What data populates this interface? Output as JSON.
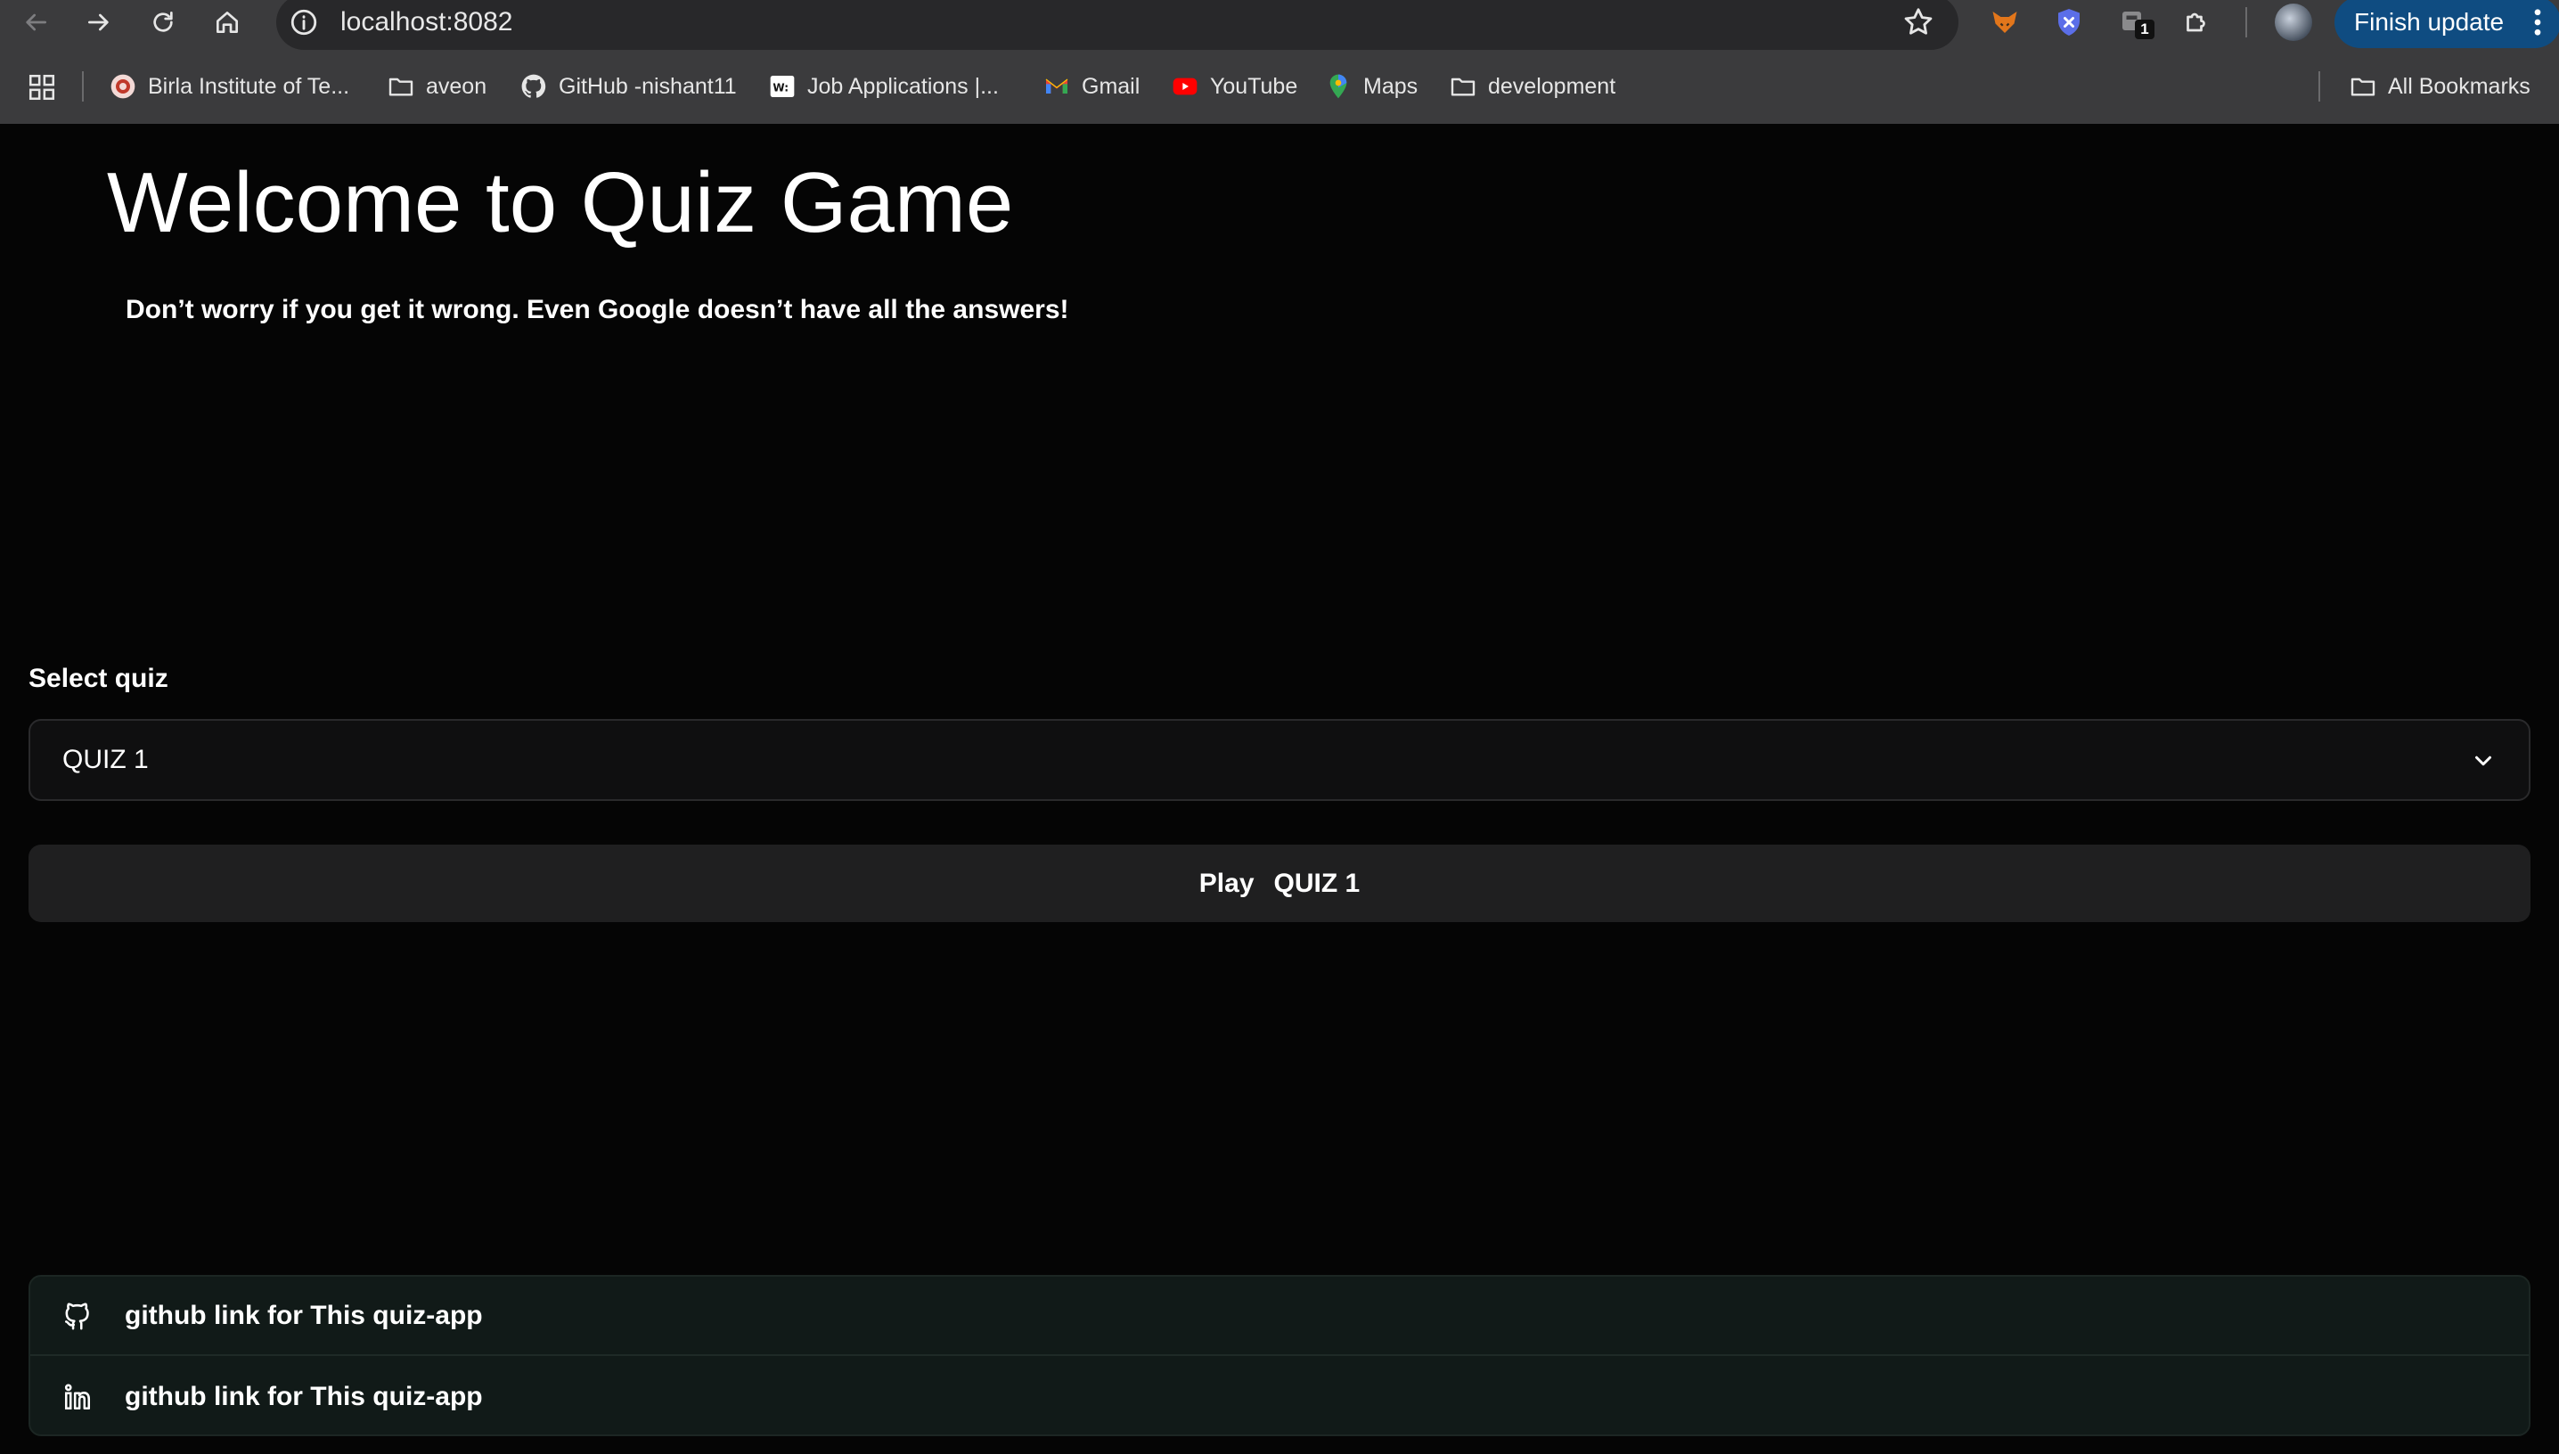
{
  "browser": {
    "url": "localhost:8082",
    "update_button": "Finish update",
    "extension_badge": "1",
    "bookmarks": [
      {
        "label": "Birla Institute of Te...",
        "icon": "site-favicon-icon"
      },
      {
        "label": "aveon",
        "icon": "folder-icon"
      },
      {
        "label": "GitHub -nishant11",
        "icon": "github-icon"
      },
      {
        "label": "Job Applications |...",
        "icon": "wellfound-icon"
      },
      {
        "label": "Gmail",
        "icon": "gmail-icon"
      },
      {
        "label": "YouTube",
        "icon": "youtube-icon"
      },
      {
        "label": "Maps",
        "icon": "maps-icon"
      },
      {
        "label": "development",
        "icon": "folder-icon"
      }
    ],
    "all_bookmarks": "All Bookmarks"
  },
  "hero": {
    "title": "Welcome to Quiz Game",
    "subtitle": "Don’t worry if you get it wrong. Even Google doesn’t have all the answers!"
  },
  "quiz": {
    "select_label": "Select quiz",
    "selected_value": "QUIZ 1",
    "play_prefix": "Play",
    "play_quiz_name": "QUIZ 1"
  },
  "links": [
    {
      "label": "github link for This quiz-app",
      "icon": "github-icon"
    },
    {
      "label": "github link for This quiz-app",
      "icon": "linkedin-icon"
    }
  ],
  "colors": {
    "background": "#050505",
    "chrome": "#3b3b3d",
    "update_button": "#0f4c81",
    "links_panel": "#111a18"
  }
}
